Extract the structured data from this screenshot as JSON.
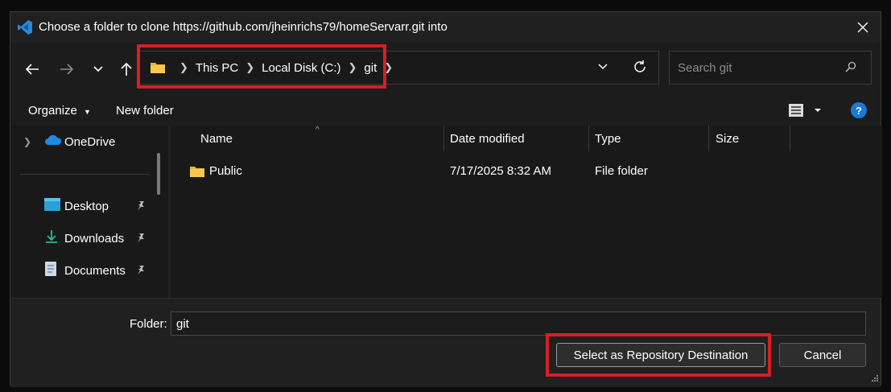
{
  "window": {
    "title": "Choose a folder to clone https://github.com/jheinrichs79/homeServarr.git into",
    "app_icon": "vscode-icon",
    "accent": "#1a78d6"
  },
  "nav": {
    "back_icon": "arrow-left-icon",
    "forward_icon": "arrow-right-icon",
    "recent_icon": "chevron-down-icon",
    "up_icon": "arrow-up-icon",
    "breadcrumbs": [
      "This PC",
      "Local Disk (C:)",
      "git"
    ],
    "search_placeholder": "Search git"
  },
  "toolbar": {
    "organize": "Organize",
    "new_folder": "New folder"
  },
  "sidebar": {
    "items": [
      {
        "label": "OneDrive",
        "icon": "cloud-icon"
      },
      {
        "label": "Desktop",
        "icon": "desktop-icon"
      },
      {
        "label": "Downloads",
        "icon": "download-icon"
      },
      {
        "label": "Documents",
        "icon": "document-icon"
      }
    ]
  },
  "filelist": {
    "columns": [
      "Name",
      "Date modified",
      "Type",
      "Size"
    ],
    "rows": [
      {
        "name": "Public",
        "date": "7/17/2025 8:32 AM",
        "type": "File folder",
        "size": ""
      }
    ]
  },
  "footer": {
    "folder_label": "Folder:",
    "folder_value": "git",
    "primary_button": "Select as Repository Destination",
    "cancel_button": "Cancel"
  },
  "highlight_color": "#d61f26"
}
